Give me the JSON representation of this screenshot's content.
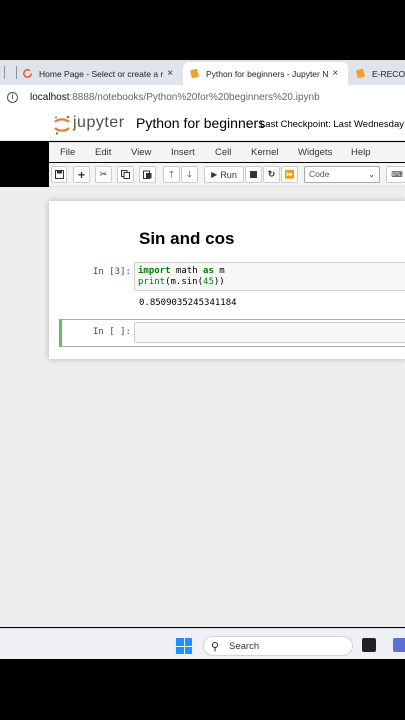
{
  "browser": {
    "tabs": [
      {
        "title": "Home Page - Select or create a r",
        "close": "×"
      },
      {
        "title": "Python for beginners - Jupyter N",
        "close": "×"
      },
      {
        "title": "E-RECOR"
      }
    ],
    "address": {
      "host": "localhost",
      "path": ":8888/notebooks/Python%20for%20beginners%20.ipynb"
    }
  },
  "jupyter": {
    "logo_text": "jupyter",
    "notebook_title": "Python for beginners",
    "checkpoint": "Last Checkpoint: Last Wednesday at"
  },
  "menu": [
    "File",
    "Edit",
    "View",
    "Insert",
    "Cell",
    "Kernel",
    "Widgets",
    "Help"
  ],
  "toolbar": {
    "run_label": "Run",
    "cell_type": "Code"
  },
  "notebook": {
    "heading": "Sin and cos",
    "cells": [
      {
        "prompt": "In [3]:",
        "code": [
          {
            "k1": "import",
            "t1": " math ",
            "k2": "as",
            "t2": " m"
          },
          {
            "b": "print",
            "t": "(m.sin(",
            "n": "45",
            "e": "))"
          }
        ],
        "output": "0.8509035245341184"
      },
      {
        "prompt": "In [ ]:"
      }
    ]
  },
  "taskbar": {
    "search_placeholder": "Search"
  },
  "colors": {
    "accent_selected_cell": "#66bb6a",
    "prompt": "#303f9f",
    "jupyter_orange": "#f37626"
  }
}
